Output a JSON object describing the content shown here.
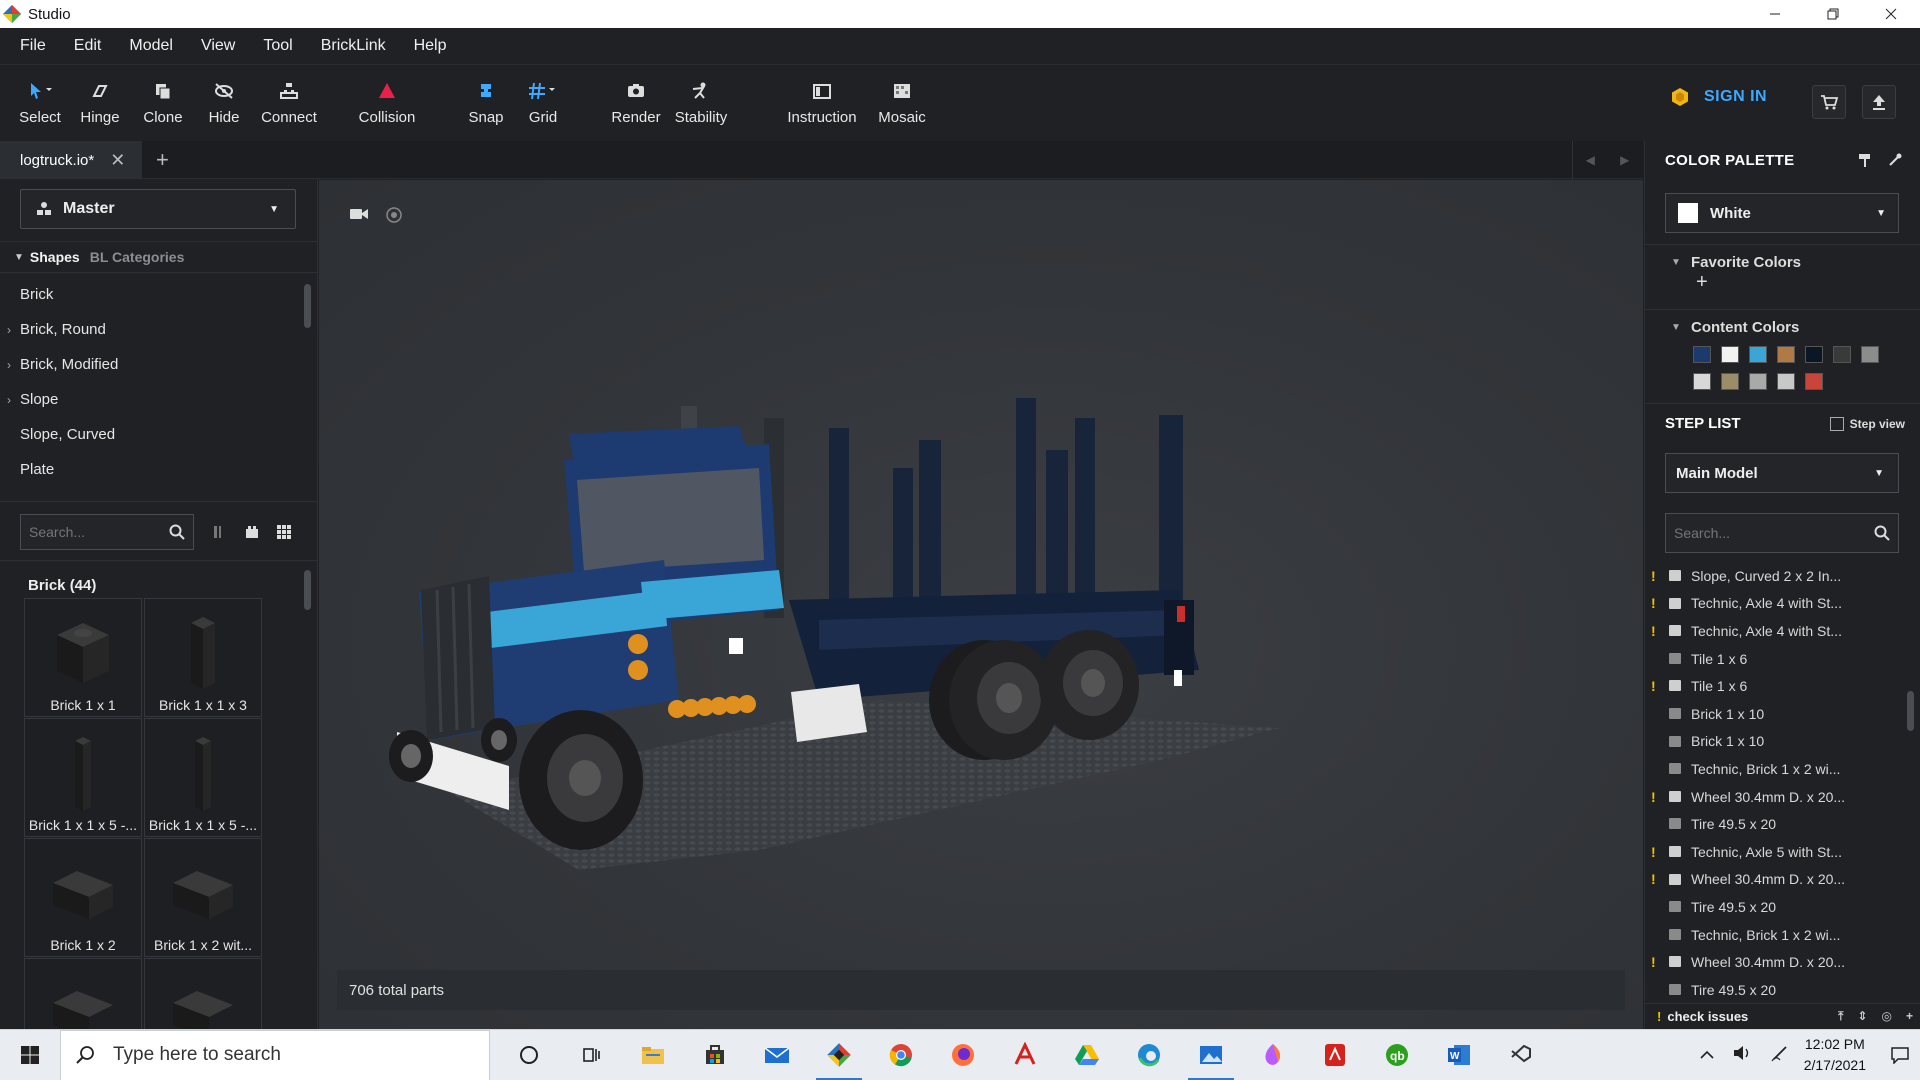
{
  "window": {
    "title": "Studio"
  },
  "menu": [
    "File",
    "Edit",
    "Model",
    "View",
    "Tool",
    "BrickLink",
    "Help"
  ],
  "toolbar": {
    "tools": [
      {
        "label": "Select",
        "icon": "cursor-icon"
      },
      {
        "label": "Hinge",
        "icon": "hinge-icon"
      },
      {
        "label": "Clone",
        "icon": "clone-icon"
      },
      {
        "label": "Hide",
        "icon": "eye-off-icon"
      },
      {
        "label": "Connect",
        "icon": "connect-icon"
      },
      {
        "label": "Collision",
        "icon": "warning-triangle-icon"
      },
      {
        "label": "Snap",
        "icon": "snap-icon"
      },
      {
        "label": "Grid",
        "icon": "grid-icon"
      },
      {
        "label": "Render",
        "icon": "camera-icon"
      },
      {
        "label": "Stability",
        "icon": "stability-icon"
      },
      {
        "label": "Instruction",
        "icon": "instruction-icon"
      },
      {
        "label": "Mosaic",
        "icon": "mosaic-icon"
      }
    ],
    "sign_in": "SIGN IN"
  },
  "tabs": {
    "active": "logtruck.io*"
  },
  "left": {
    "master": "Master",
    "tab_shapes": "Shapes",
    "tab_categories": "BL Categories",
    "categories": [
      {
        "label": "Brick",
        "expandable": false
      },
      {
        "label": "Brick, Round",
        "expandable": true
      },
      {
        "label": "Brick, Modified",
        "expandable": true
      },
      {
        "label": "Slope",
        "expandable": true
      },
      {
        "label": "Slope, Curved",
        "expandable": false
      },
      {
        "label": "Plate",
        "expandable": false
      }
    ],
    "search_placeholder": "Search...",
    "brick_header": "Brick (44)",
    "bricks": [
      "Brick 1 x 1",
      "Brick 1 x 1 x 3",
      "Brick 1 x 1 x 5 -...",
      "Brick 1 x 1 x 5 -...",
      "Brick 1 x 2",
      "Brick 1 x 2 wit...",
      "",
      ""
    ]
  },
  "viewport": {
    "status": "706 total parts"
  },
  "right": {
    "color_palette_title": "COLOR PALETTE",
    "selected_color": "White",
    "favorite_colors": "Favorite Colors",
    "content_colors": "Content Colors",
    "swatches": [
      "#1c3a6e",
      "#f2f2f2",
      "#3aa6d8",
      "#b07a45",
      "#0d1624",
      "#3a3a3a",
      "#8c8c8c",
      "#d8d8d8",
      "#9c8d6a",
      "#a9a9a9",
      "#c8c8c8",
      "#c8453a"
    ],
    "step_list_title": "STEP LIST",
    "step_view": "Step view",
    "model": "Main Model",
    "search_placeholder": "Search...",
    "steps": [
      {
        "label": "Slope, Curved 2 x 2 In...",
        "warn": true
      },
      {
        "label": "Technic, Axle 4 with St...",
        "warn": true
      },
      {
        "label": "Technic, Axle 4 with St...",
        "warn": true
      },
      {
        "label": "Tile 1 x 6",
        "warn": false
      },
      {
        "label": "Tile 1 x 6",
        "warn": true
      },
      {
        "label": "Brick 1 x 10",
        "warn": false
      },
      {
        "label": "Brick 1 x 10",
        "warn": false
      },
      {
        "label": "Technic, Brick 1 x 2 wi...",
        "warn": false
      },
      {
        "label": "Wheel 30.4mm D. x 20...",
        "warn": true
      },
      {
        "label": "Tire 49.5 x 20",
        "warn": false
      },
      {
        "label": "Technic, Axle 5 with St...",
        "warn": true
      },
      {
        "label": "Wheel 30.4mm D. x 20...",
        "warn": true
      },
      {
        "label": "Tire 49.5 x 20",
        "warn": false
      },
      {
        "label": "Technic, Brick 1 x 2 wi...",
        "warn": false
      },
      {
        "label": "Wheel 30.4mm D. x 20...",
        "warn": true
      },
      {
        "label": "Tire 49.5 x 20",
        "warn": false
      }
    ],
    "check_issues": "check issues"
  },
  "taskbar": {
    "search_placeholder": "Type here to search",
    "time": "12:02 PM",
    "date": "2/17/2021"
  }
}
